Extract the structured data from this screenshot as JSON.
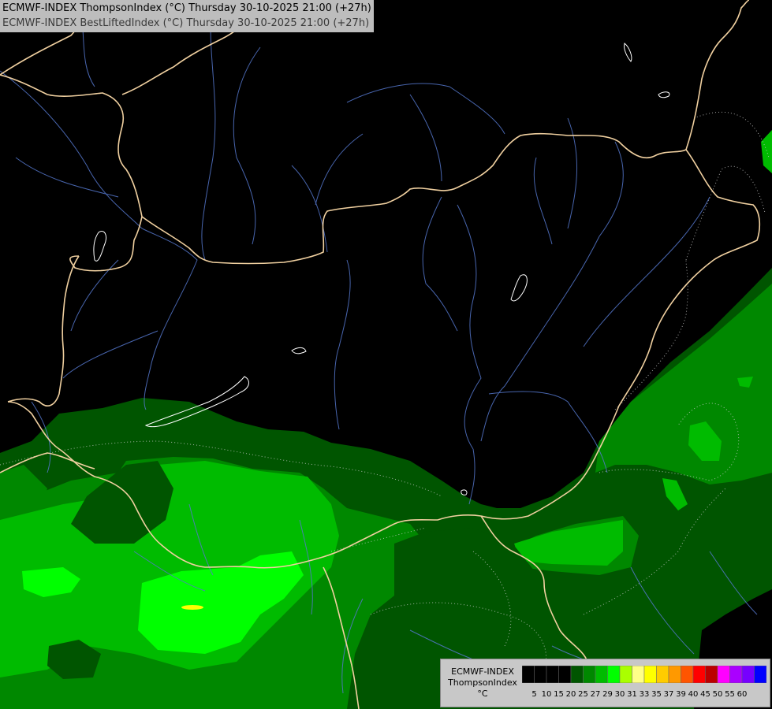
{
  "header": {
    "line1": "ECMWF-INDEX ThompsonIndex (°C) Thursday 30-10-2025 21:00 (+27h)",
    "line2": "ECMWF-INDEX BestLiftedIndex (°C) Thursday 30-10-2025 21:00 (+27h)"
  },
  "legend": {
    "source": "ECMWF-INDEX",
    "parameter": "ThompsonIndex",
    "unit": "°C",
    "ticks": [
      "5",
      "10",
      "15",
      "20",
      "25",
      "27",
      "29",
      "30",
      "31",
      "33",
      "35",
      "37",
      "39",
      "40",
      "45",
      "50",
      "55",
      "60"
    ],
    "colors": [
      "#000000",
      "#000000",
      "#000000",
      "#000000",
      "#005500",
      "#008800",
      "#00bb00",
      "#00ff00",
      "#aaff00",
      "#ffff88",
      "#ffff00",
      "#ffcc00",
      "#ff9900",
      "#ff5500",
      "#ff0000",
      "#bb0000",
      "#ff00ff",
      "#aa00ff",
      "#7700ff",
      "#0000ff"
    ]
  },
  "map": {
    "colors": {
      "background": "#000000",
      "dark_green": "#005500",
      "mid_green": "#008800",
      "bright_green": "#00bb00",
      "lime": "#00ff00",
      "yellow": "#ffff00",
      "border": "#f0d0a0",
      "river": "#5577cc",
      "lake": "#ffffff",
      "contour": "#cccccc"
    }
  }
}
